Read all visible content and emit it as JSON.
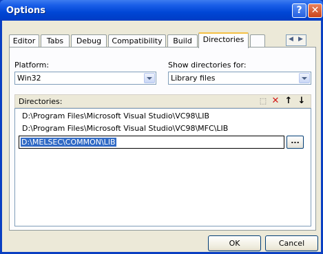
{
  "window": {
    "title": "Options",
    "help_glyph": "?",
    "close_glyph": "✕"
  },
  "tabs": [
    {
      "label": "Editor"
    },
    {
      "label": "Tabs"
    },
    {
      "label": "Debug"
    },
    {
      "label": "Compatibility"
    },
    {
      "label": "Build"
    },
    {
      "label": "Directories",
      "active": true
    }
  ],
  "platform": {
    "label": "Platform:",
    "value": "Win32"
  },
  "show_dirs": {
    "label": "Show directories for:",
    "value": "Library files"
  },
  "directories": {
    "label": "Directories:",
    "items": [
      "D:\\Program Files\\Microsoft Visual Studio\\VC98\\LIB",
      "D:\\Program Files\\Microsoft Visual Studio\\VC98\\MFC\\LIB"
    ],
    "editing_value": "D:\\MELSEC\\COMMON\\LIB",
    "browse_label": "..."
  },
  "toolbar_icons": [
    "new-folder-icon",
    "delete-icon",
    "move-up-icon",
    "move-down-icon"
  ],
  "buttons": {
    "ok": "OK",
    "cancel": "Cancel"
  },
  "colors": {
    "title_bar": "#0046d5",
    "selection": "#316ac5",
    "active_tab_accent": "#f5c043"
  }
}
